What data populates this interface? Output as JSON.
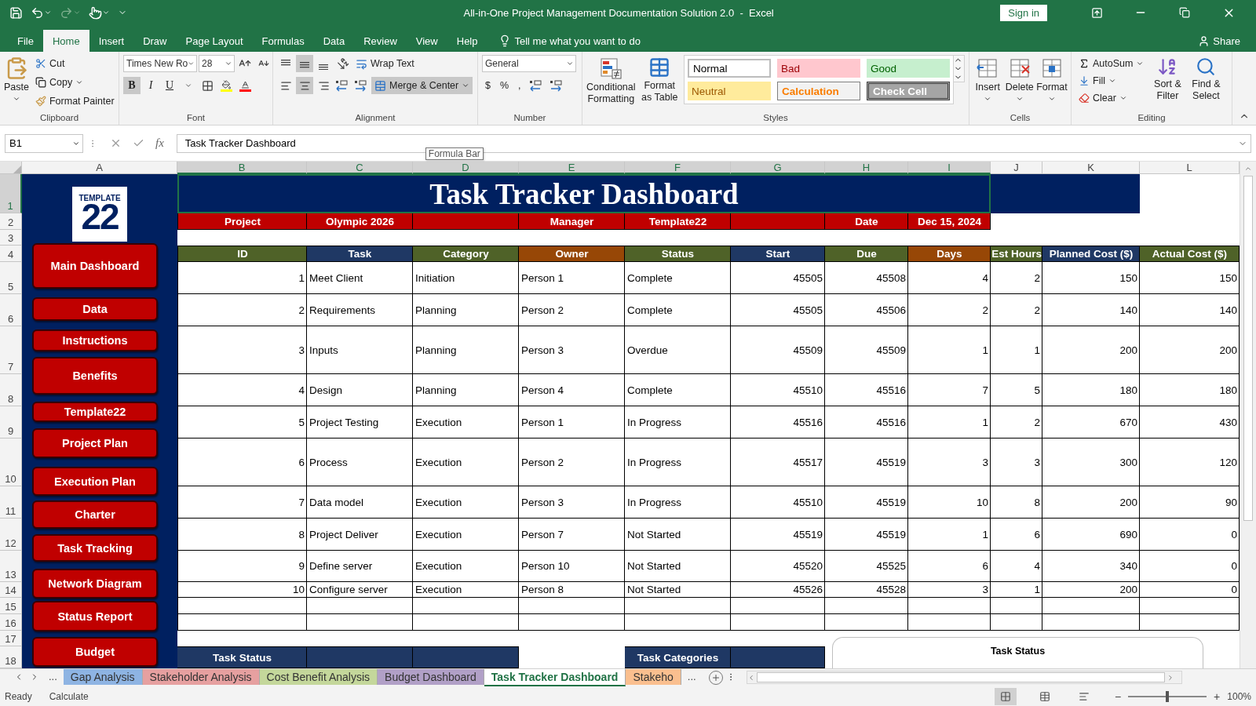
{
  "title_bar": {
    "title": "All-in-One Project Management Documentation Solution 2.0  -  Excel",
    "sign_in": "Sign in"
  },
  "menu_tabs": [
    {
      "label": "File",
      "selected": false
    },
    {
      "label": "Home",
      "selected": true
    },
    {
      "label": "Insert",
      "selected": false
    },
    {
      "label": "Draw",
      "selected": false
    },
    {
      "label": "Page Layout",
      "selected": false
    },
    {
      "label": "Formulas",
      "selected": false
    },
    {
      "label": "Data",
      "selected": false
    },
    {
      "label": "Review",
      "selected": false
    },
    {
      "label": "View",
      "selected": false
    },
    {
      "label": "Help",
      "selected": false
    }
  ],
  "tell_me": "Tell me what you want to do",
  "share": "Share",
  "ribbon": {
    "clipboard": {
      "label": "Clipboard",
      "paste": "Paste",
      "cut": "Cut",
      "copy": "Copy",
      "format_painter": "Format Painter"
    },
    "font": {
      "label": "Font",
      "font_name": "Times New Ro",
      "font_size": "28",
      "styles": [
        {
          "label": "B",
          "selected": true
        },
        {
          "label": "I",
          "selected": false
        },
        {
          "label": "U",
          "selected": false
        }
      ]
    },
    "alignment": {
      "label": "Alignment",
      "vertical": [
        {
          "selected": false
        },
        {
          "selected": true
        },
        {
          "selected": false
        }
      ],
      "horizontal": [
        {
          "selected": false
        },
        {
          "selected": true
        },
        {
          "selected": false
        }
      ],
      "wrap_text": "Wrap Text",
      "merge_center": {
        "label": "Merge & Center",
        "selected": true
      }
    },
    "number": {
      "label": "Number",
      "format": "General",
      "symbols": [
        "$",
        "%",
        ","
      ]
    },
    "styles": {
      "label": "Styles",
      "conditional": "Conditional Formatting",
      "format_table": "Format as Table",
      "gallery": [
        {
          "label": "Normal",
          "kind": "normal"
        },
        {
          "label": "Bad",
          "kind": "bad"
        },
        {
          "label": "Good",
          "kind": "good"
        },
        {
          "label": "Neutral",
          "kind": "neutral"
        },
        {
          "label": "Calculation",
          "kind": "calculation"
        },
        {
          "label": "Check Cell",
          "kind": "check"
        }
      ]
    },
    "cells": {
      "label": "Cells",
      "buttons": [
        {
          "label": "Insert",
          "kind": "insert"
        },
        {
          "label": "Delete",
          "kind": "delete"
        },
        {
          "label": "Format",
          "kind": "format"
        }
      ]
    },
    "editing": {
      "label": "Editing",
      "autosum": "AutoSum",
      "fill": "Fill",
      "clear": "Clear",
      "sort_filter": "Sort & Filter",
      "find_select": "Find & Select"
    }
  },
  "formula_bar": {
    "name_box": "B1",
    "fx": "fx",
    "formula": "Task Tracker Dashboard",
    "tooltip": "Formula Bar"
  },
  "columns": [
    {
      "label": "A",
      "selected": false
    },
    {
      "label": "B",
      "selected": true
    },
    {
      "label": "C",
      "selected": true
    },
    {
      "label": "D",
      "selected": true
    },
    {
      "label": "E",
      "selected": true
    },
    {
      "label": "F",
      "selected": true
    },
    {
      "label": "G",
      "selected": true
    },
    {
      "label": "H",
      "selected": true
    },
    {
      "label": "I",
      "selected": true
    },
    {
      "label": "J",
      "selected": false
    },
    {
      "label": "K",
      "selected": false
    },
    {
      "label": "L",
      "selected": false
    }
  ],
  "rows": [
    {
      "label": "1",
      "selected": true
    },
    {
      "label": "2",
      "selected": false
    },
    {
      "label": "3",
      "selected": false
    },
    {
      "label": "4",
      "selected": false
    },
    {
      "label": "5",
      "selected": false
    },
    {
      "label": "6",
      "selected": false
    },
    {
      "label": "7",
      "selected": false
    },
    {
      "label": "8",
      "selected": false
    },
    {
      "label": "9",
      "selected": false
    },
    {
      "label": "10",
      "selected": false
    },
    {
      "label": "11",
      "selected": false
    },
    {
      "label": "12",
      "selected": false
    },
    {
      "label": "13",
      "selected": false
    },
    {
      "label": "14",
      "selected": false
    },
    {
      "label": "15",
      "selected": false
    },
    {
      "label": "16",
      "selected": false
    },
    {
      "label": "17",
      "selected": false
    },
    {
      "label": "18",
      "selected": false
    }
  ],
  "sidebar": {
    "logo_label": "TEMPLATE",
    "logo_number": "22",
    "buttons": [
      "Main Dashboard",
      "Data",
      "Instructions",
      "Benefits",
      "Template22",
      "Project Plan",
      "Execution Plan",
      "Charter",
      "Task Tracking",
      "Network Diagram",
      "Status Report",
      "Budget"
    ]
  },
  "sheet": {
    "title": "Task Tracker Dashboard",
    "info": [
      {
        "label": "Project",
        "value": "Olympic 2026"
      },
      {
        "label": "Manager",
        "value": "Template22"
      },
      {
        "label": "Date",
        "value": "Dec 15, 2024"
      }
    ],
    "table": {
      "columns": [
        {
          "label": "ID",
          "color": "#4f6228",
          "kind": "number"
        },
        {
          "label": "Task",
          "color": "#1f3864",
          "kind": "text"
        },
        {
          "label": "Category",
          "color": "#4f6228",
          "kind": "text"
        },
        {
          "label": "Owner",
          "color": "#974706",
          "kind": "text"
        },
        {
          "label": "Status",
          "color": "#4f6228",
          "kind": "text"
        },
        {
          "label": "Start",
          "color": "#1f3864",
          "kind": "number"
        },
        {
          "label": "Due",
          "color": "#4f6228",
          "kind": "number"
        },
        {
          "label": "Days",
          "color": "#974706",
          "kind": "number"
        },
        {
          "label": "Est Hours",
          "color": "#4f6228",
          "kind": "number"
        },
        {
          "label": "Planned Cost ($)",
          "color": "#1f3864",
          "kind": "number"
        },
        {
          "label": "Actual Cost ($)",
          "color": "#4f6228",
          "kind": "number"
        }
      ],
      "rows": [
        [
          "1",
          "Meet Client",
          "Initiation",
          "Person 1",
          "Complete",
          "45505",
          "45508",
          "4",
          "2",
          "150",
          "150"
        ],
        [
          "2",
          "Requirements",
          "Planning",
          "Person 2",
          "Complete",
          "45505",
          "45506",
          "2",
          "2",
          "140",
          "140"
        ],
        [
          "3",
          "Inputs",
          "Planning",
          "Person 3",
          "Overdue",
          "45509",
          "45509",
          "1",
          "1",
          "200",
          "200"
        ],
        [
          "4",
          "Design",
          "Planning",
          "Person 4",
          "Complete",
          "45510",
          "45516",
          "7",
          "5",
          "180",
          "180"
        ],
        [
          "5",
          "Project Testing",
          "Execution",
          "Person 1",
          "In Progress",
          "45516",
          "45516",
          "1",
          "2",
          "670",
          "430"
        ],
        [
          "6",
          "Process",
          "Execution",
          "Person 2",
          "In Progress",
          "45517",
          "45519",
          "3",
          "3",
          "300",
          "120"
        ],
        [
          "7",
          "Data model",
          "Execution",
          "Person 3",
          "In Progress",
          "45510",
          "45519",
          "10",
          "8",
          "200",
          "90"
        ],
        [
          "8",
          "Project Deliver",
          "Execution",
          "Person 7",
          "Not Started",
          "45519",
          "45519",
          "1",
          "6",
          "690",
          "0"
        ],
        [
          "9",
          "Define server",
          "Execution",
          "Person 10",
          "Not Started",
          "45520",
          "45525",
          "6",
          "4",
          "340",
          "0"
        ],
        [
          "10",
          "Configure server",
          "Execution",
          "Person 8",
          "Not Started",
          "45526",
          "45528",
          "3",
          "1",
          "200",
          "0"
        ]
      ]
    },
    "sections": [
      {
        "title": "Task Status"
      },
      {
        "title": "Task Categories"
      }
    ],
    "chart_panel": {
      "title": "Task Status"
    }
  },
  "sheet_tabs": {
    "more_left": "...",
    "items": [
      {
        "label": "Gap Analysis",
        "color": "#8eb4e3",
        "selected": false
      },
      {
        "label": "Stakeholder Analysis",
        "color": "#e6a0a0",
        "selected": false
      },
      {
        "label": "Cost Benefit Analysis",
        "color": "#c4d79b",
        "selected": false
      },
      {
        "label": "Budget Dashboard",
        "color": "#b1a0c7",
        "selected": false
      },
      {
        "label": "Task Tracker Dashboard",
        "color": "#ffffff",
        "selected": true
      },
      {
        "label": "Stakeho",
        "color": "#fabf8f",
        "selected": false
      }
    ],
    "more_right": "..."
  },
  "status_bar": {
    "mode": "Ready",
    "calc": "Calculate",
    "zoom_out": "−",
    "zoom_in": "+",
    "zoom": "100%",
    "zoom_slider": {
      "level": 0.5
    }
  }
}
